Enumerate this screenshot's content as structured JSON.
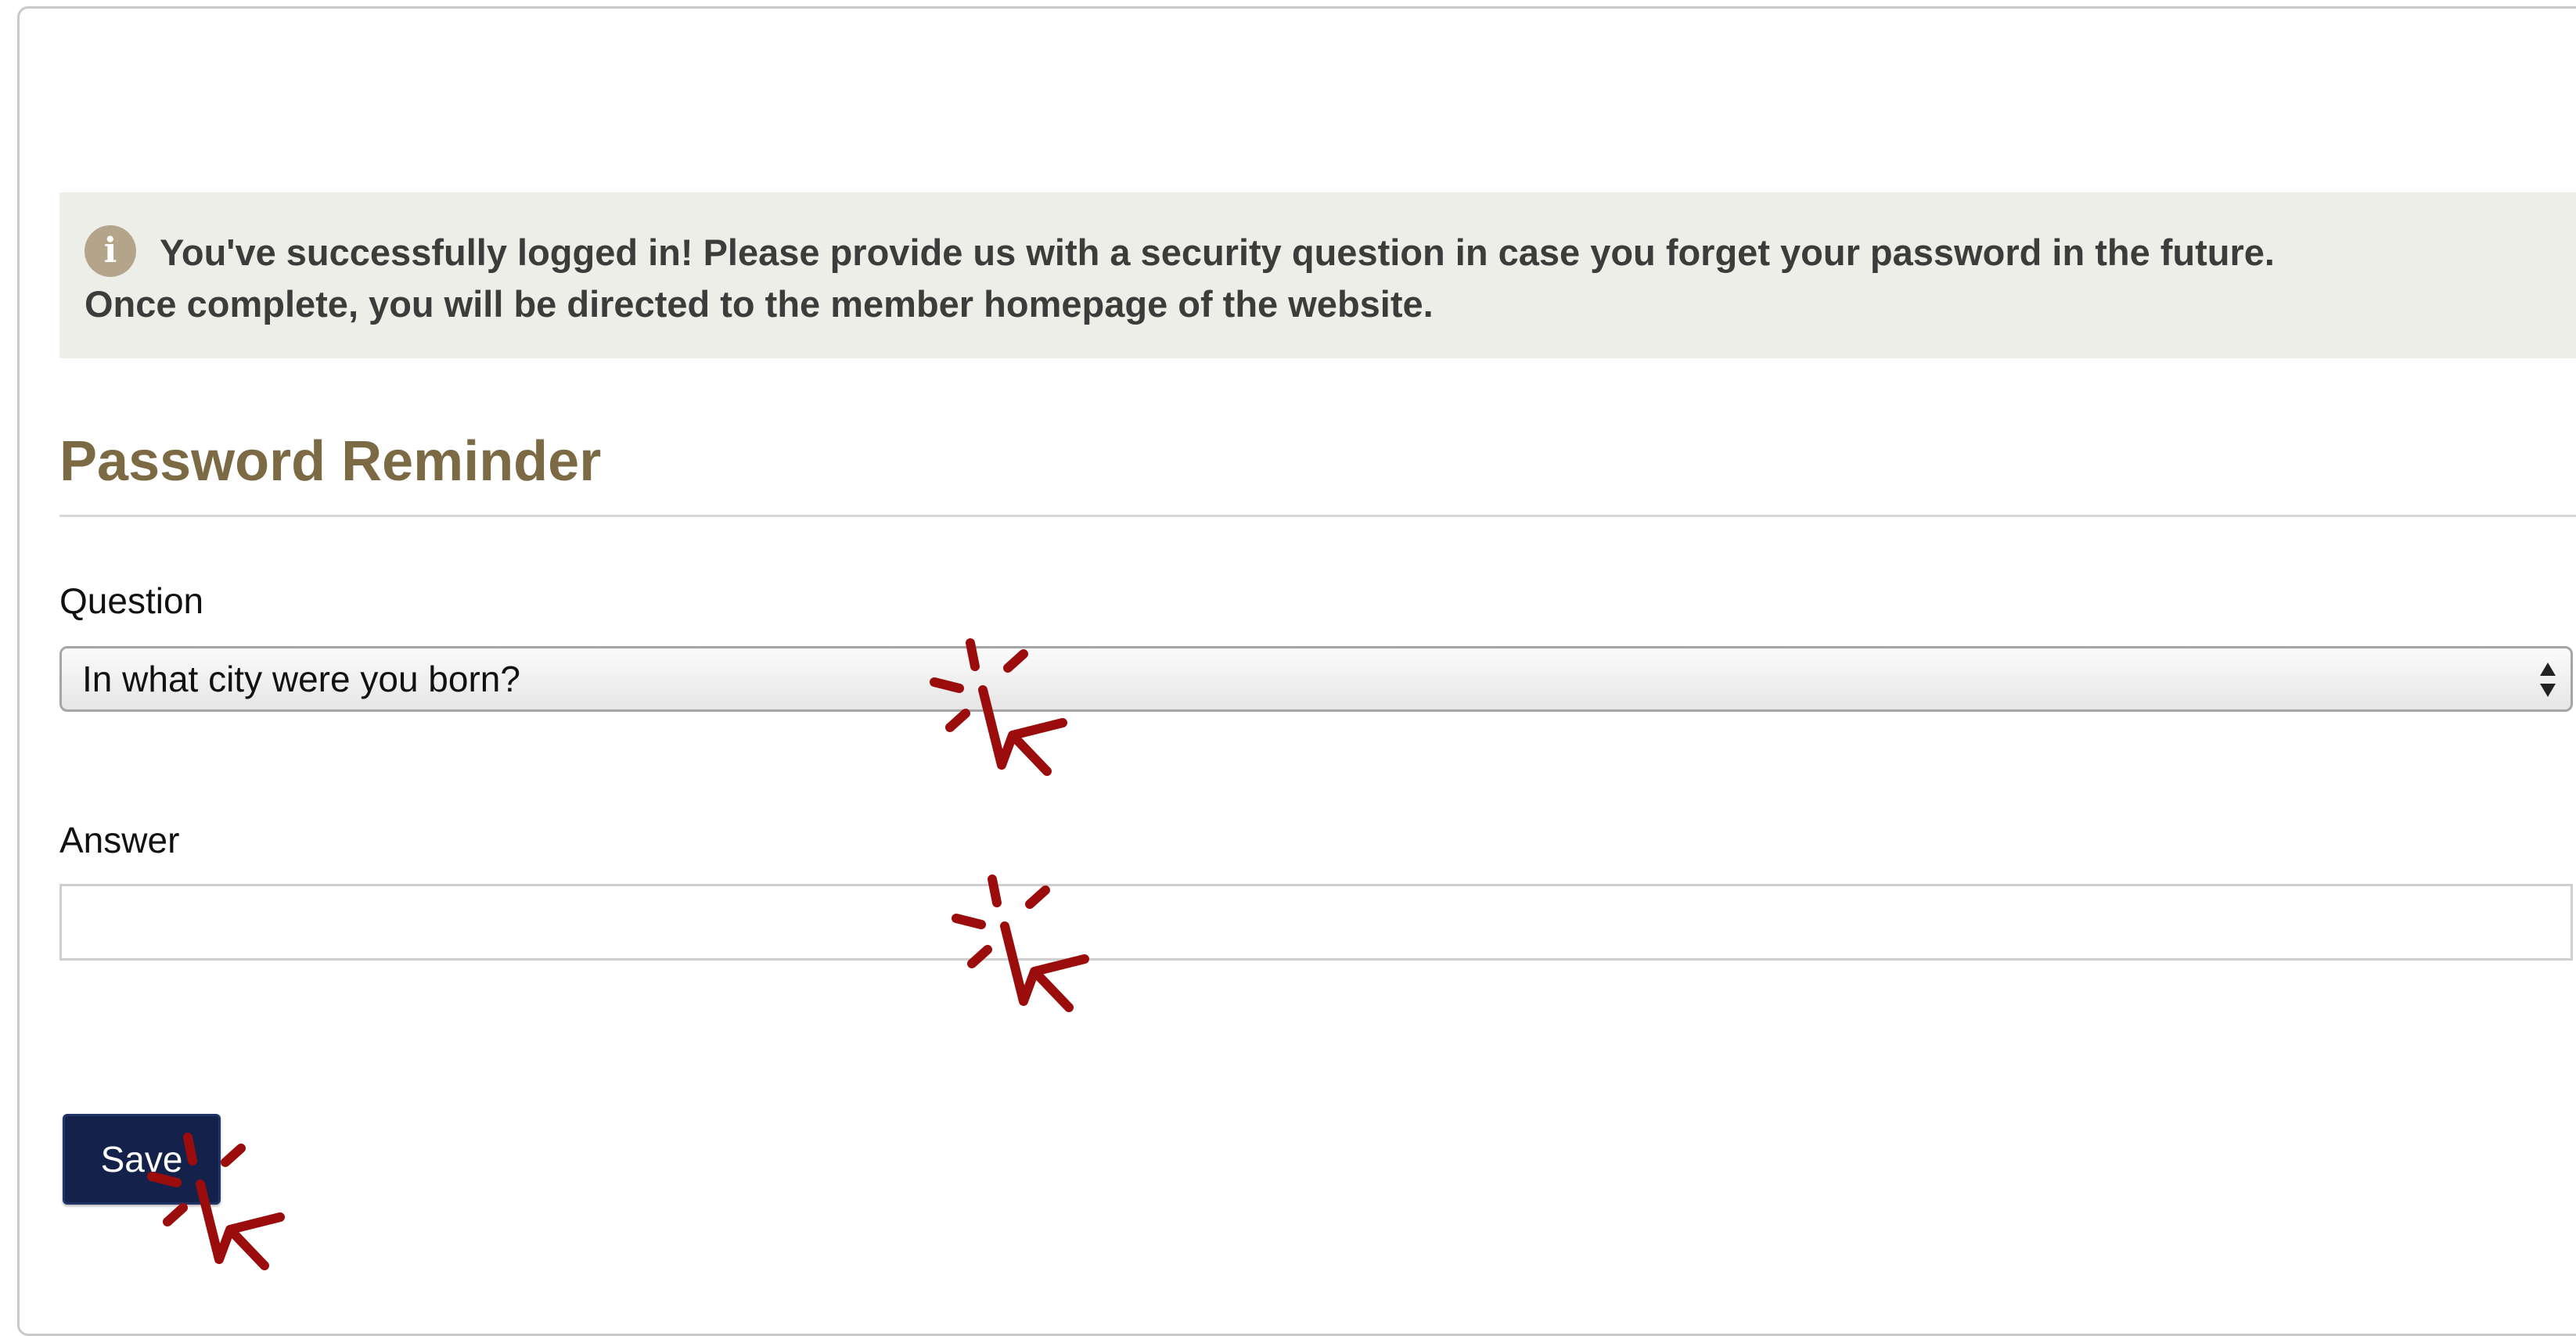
{
  "alert": {
    "icon": "info-icon",
    "line1": "You've successfully logged in! Please provide us with a security question in case you forget your password in the future.",
    "line2": "Once complete, you will be directed to the member homepage of the website."
  },
  "form": {
    "title": "Password Reminder",
    "question_label": "Question",
    "question_selected": "In what city were you born?",
    "answer_label": "Answer",
    "answer_value": "",
    "save_label": "Save"
  },
  "overlays": {
    "cursor_icon": "click-cursor-icon",
    "cursor_color": "#9b0d0d"
  },
  "colors": {
    "title": "#7c6a44",
    "button_bg": "#14214a",
    "alert_bg": "#eeeee9",
    "info_icon_bg": "#b3a48a"
  }
}
